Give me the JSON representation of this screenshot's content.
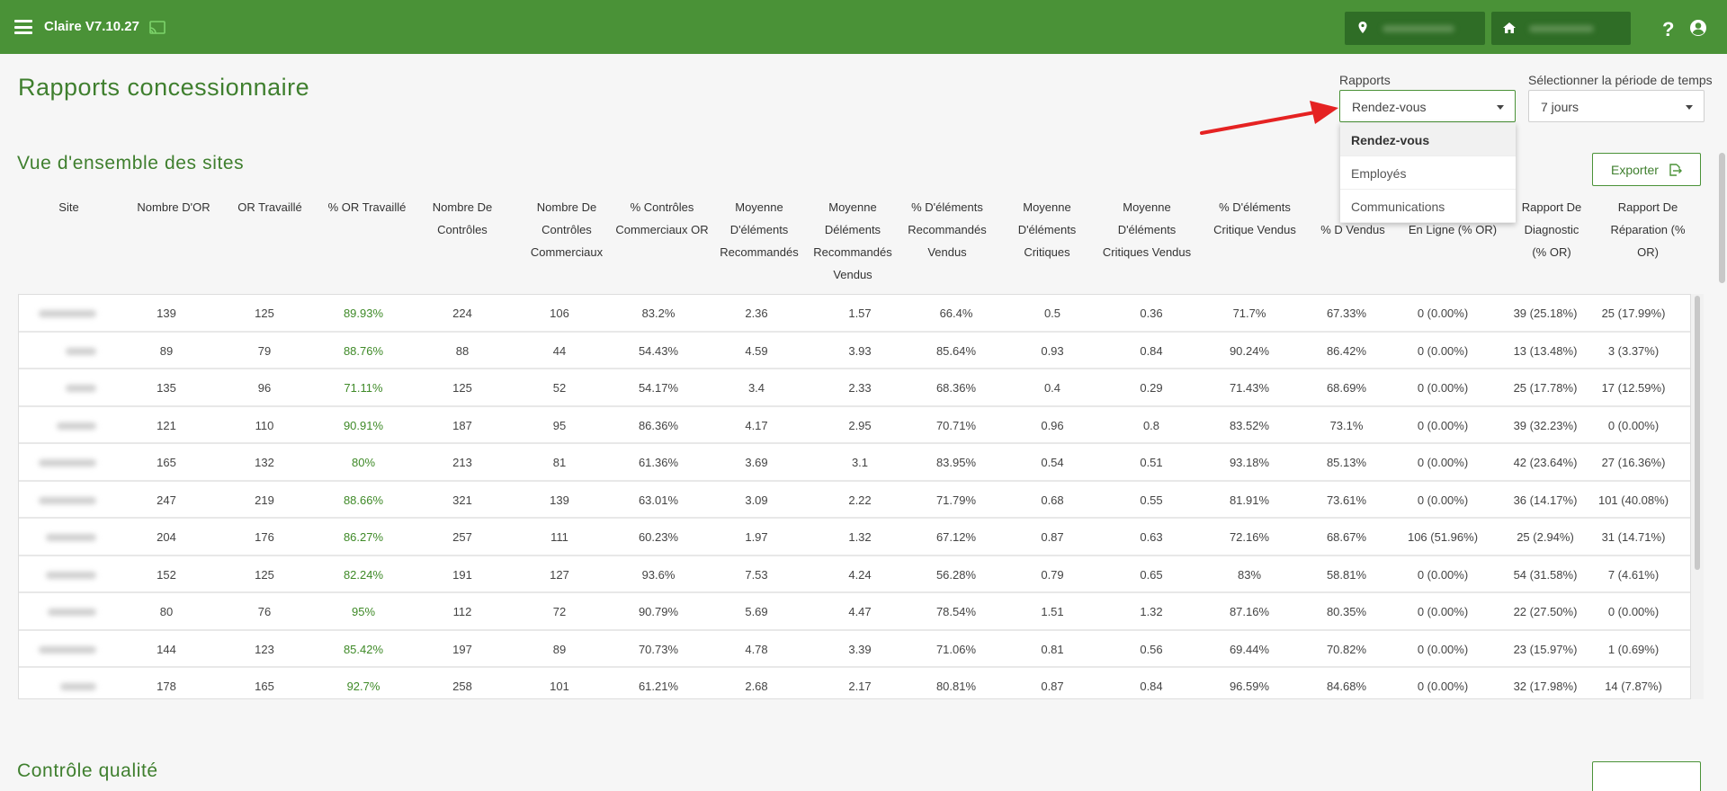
{
  "topbar": {
    "app_title": "Claire V7.10.27",
    "location_icon": "map-pin-icon",
    "home_icon": "home-icon",
    "help_label": "?",
    "user_icon": "user-circle-icon"
  },
  "page": {
    "title": "Rapports concessionnaire",
    "section_title": "Vue d'ensemble des sites",
    "section2_title": "Contrôle qualité"
  },
  "filters": {
    "reports_label": "Rapports",
    "reports_value": "Rendez-vous",
    "reports_options": [
      "Rendez-vous",
      "Employés",
      "Communications"
    ],
    "period_label": "Sélectionner la période de temps",
    "period_value": "7 jours"
  },
  "export_label": "Exporter",
  "table": {
    "headers": [
      "Site",
      "Nombre D'OR",
      "OR Travaillé",
      "% OR Travaillé",
      "Nombre De Contrôles",
      "Nombre De Contrôles Commerciaux",
      "% Contrôles Commerciaux OR",
      "Moyenne D'éléments Recommandés",
      "Moyenne Déléments Recommandés Vendus",
      "% D'éléments Recommandés Vendus",
      "Moyenne D'éléments Critiques",
      "Moyenne D'éléments Critiques Vendus",
      "% D'éléments Critique Vendus",
      "% D Vendus",
      "En Ligne (% OR)",
      "Rapport De Diagnostic (% OR)",
      "Rapport De Réparation (% OR)"
    ],
    "rows": [
      [
        "139",
        "125",
        "89.93%",
        "224",
        "106",
        "83.2%",
        "2.36",
        "1.57",
        "66.4%",
        "0.5",
        "0.36",
        "71.7%",
        "67.33%",
        "0 (0.00%)",
        "39 (25.18%)",
        "25 (17.99%)"
      ],
      [
        "89",
        "79",
        "88.76%",
        "88",
        "44",
        "54.43%",
        "4.59",
        "3.93",
        "85.64%",
        "0.93",
        "0.84",
        "90.24%",
        "86.42%",
        "0 (0.00%)",
        "13 (13.48%)",
        "3 (3.37%)"
      ],
      [
        "135",
        "96",
        "71.11%",
        "125",
        "52",
        "54.17%",
        "3.4",
        "2.33",
        "68.36%",
        "0.4",
        "0.29",
        "71.43%",
        "68.69%",
        "0 (0.00%)",
        "25 (17.78%)",
        "17 (12.59%)"
      ],
      [
        "121",
        "110",
        "90.91%",
        "187",
        "95",
        "86.36%",
        "4.17",
        "2.95",
        "70.71%",
        "0.96",
        "0.8",
        "83.52%",
        "73.1%",
        "0 (0.00%)",
        "39 (32.23%)",
        "0 (0.00%)"
      ],
      [
        "165",
        "132",
        "80%",
        "213",
        "81",
        "61.36%",
        "3.69",
        "3.1",
        "83.95%",
        "0.54",
        "0.51",
        "93.18%",
        "85.13%",
        "0 (0.00%)",
        "42 (23.64%)",
        "27 (16.36%)"
      ],
      [
        "247",
        "219",
        "88.66%",
        "321",
        "139",
        "63.01%",
        "3.09",
        "2.22",
        "71.79%",
        "0.68",
        "0.55",
        "81.91%",
        "73.61%",
        "0 (0.00%)",
        "36 (14.17%)",
        "101 (40.08%)"
      ],
      [
        "204",
        "176",
        "86.27%",
        "257",
        "111",
        "60.23%",
        "1.97",
        "1.32",
        "67.12%",
        "0.87",
        "0.63",
        "72.16%",
        "68.67%",
        "106 (51.96%)",
        "25 (2.94%)",
        "31 (14.71%)"
      ],
      [
        "152",
        "125",
        "82.24%",
        "191",
        "127",
        "93.6%",
        "7.53",
        "4.24",
        "56.28%",
        "0.79",
        "0.65",
        "83%",
        "58.81%",
        "0 (0.00%)",
        "54 (31.58%)",
        "7 (4.61%)"
      ],
      [
        "80",
        "76",
        "95%",
        "112",
        "72",
        "90.79%",
        "5.69",
        "4.47",
        "78.54%",
        "1.51",
        "1.32",
        "87.16%",
        "80.35%",
        "0 (0.00%)",
        "22 (27.50%)",
        "0 (0.00%)"
      ],
      [
        "144",
        "123",
        "85.42%",
        "197",
        "89",
        "70.73%",
        "4.78",
        "3.39",
        "71.06%",
        "0.81",
        "0.56",
        "69.44%",
        "70.82%",
        "0 (0.00%)",
        "23 (15.97%)",
        "1 (0.69%)"
      ],
      [
        "178",
        "165",
        "92.7%",
        "258",
        "101",
        "61.21%",
        "2.68",
        "2.17",
        "80.81%",
        "0.87",
        "0.84",
        "96.59%",
        "84.68%",
        "0 (0.00%)",
        "32 (17.98%)",
        "14 (7.87%)"
      ]
    ]
  },
  "colors": {
    "brand_green": "#4a9237",
    "title_green": "#3f7f2e",
    "value_green": "#3f8a28",
    "arrow_red": "#e52222"
  }
}
